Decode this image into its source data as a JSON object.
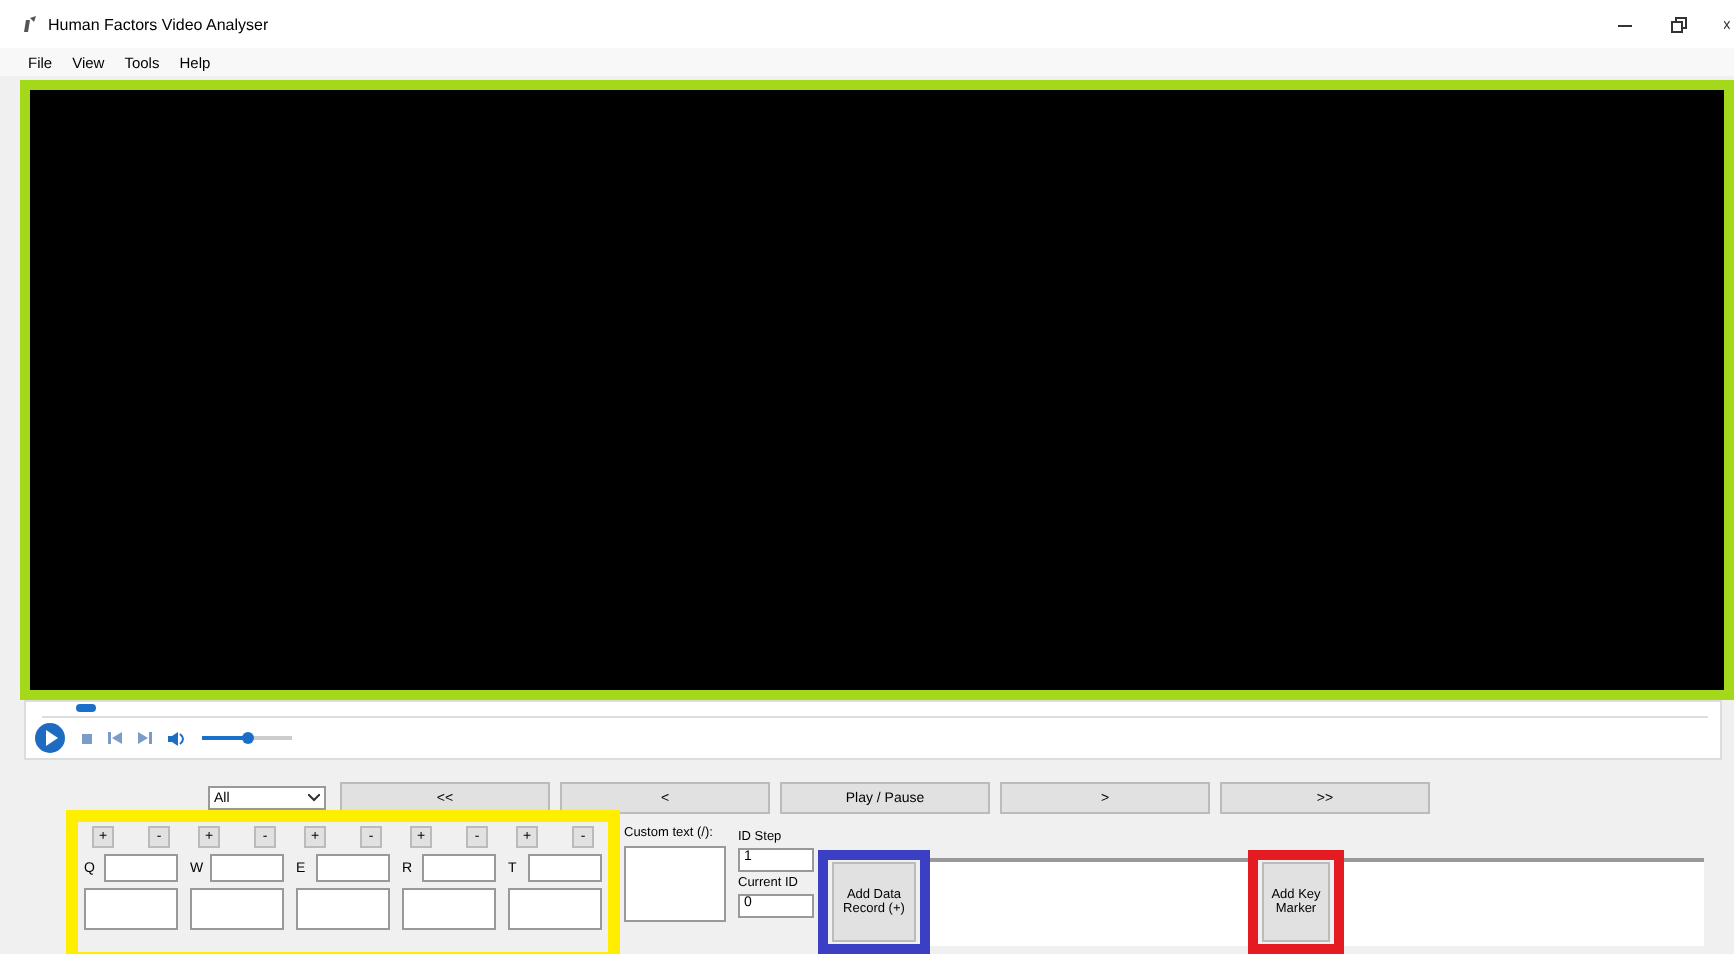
{
  "window": {
    "title": "Human Factors Video Analyser"
  },
  "menu": [
    "File",
    "View",
    "Tools",
    "Help"
  ],
  "video": {
    "color": "#a4d81a"
  },
  "seek": {
    "level": 0.02
  },
  "volume": {
    "level": 0.5
  },
  "filter": {
    "value": "All"
  },
  "playback_buttons": [
    "<<",
    "<",
    "Play / Pause",
    ">",
    ">>"
  ],
  "keys": {
    "color": "#ffee00",
    "items": [
      {
        "key": "Q",
        "plus": "+",
        "minus": "-"
      },
      {
        "key": "W",
        "plus": "+",
        "minus": "-"
      },
      {
        "key": "E",
        "plus": "+",
        "minus": "-"
      },
      {
        "key": "R",
        "plus": "+",
        "minus": "-"
      },
      {
        "key": "T",
        "plus": "+",
        "minus": "-"
      }
    ]
  },
  "custom_text": {
    "label": "Custom text (/):"
  },
  "id_step": {
    "label": "ID Step",
    "value": "1"
  },
  "current_id": {
    "label": "Current ID",
    "value": "0"
  },
  "add_data_record": {
    "label": "Add Data Record (+)",
    "color": "#3b3fc4"
  },
  "add_key_marker": {
    "label": "Add Key Marker",
    "color": "#e41b23"
  }
}
